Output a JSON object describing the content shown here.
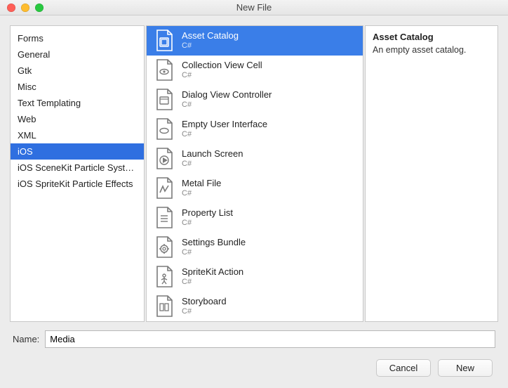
{
  "window": {
    "title": "New File"
  },
  "categories": [
    {
      "label": "Forms",
      "selected": false
    },
    {
      "label": "General",
      "selected": false
    },
    {
      "label": "Gtk",
      "selected": false
    },
    {
      "label": "Misc",
      "selected": false
    },
    {
      "label": "Text Templating",
      "selected": false
    },
    {
      "label": "Web",
      "selected": false
    },
    {
      "label": "XML",
      "selected": false
    },
    {
      "label": "iOS",
      "selected": true
    },
    {
      "label": "iOS SceneKit Particle Systems",
      "selected": false
    },
    {
      "label": "iOS SpriteKit Particle Effects",
      "selected": false
    }
  ],
  "templates": [
    {
      "label": "Asset Catalog",
      "sub": "C#",
      "icon": "asset-catalog-icon",
      "selected": true
    },
    {
      "label": "Collection View Cell",
      "sub": "C#",
      "icon": "view-cell-icon",
      "selected": false
    },
    {
      "label": "Dialog View Controller",
      "sub": "C#",
      "icon": "dialog-controller-icon",
      "selected": false
    },
    {
      "label": "Empty User Interface",
      "sub": "C#",
      "icon": "empty-ui-icon",
      "selected": false
    },
    {
      "label": "Launch Screen",
      "sub": "C#",
      "icon": "launch-screen-icon",
      "selected": false
    },
    {
      "label": "Metal File",
      "sub": "C#",
      "icon": "metal-file-icon",
      "selected": false
    },
    {
      "label": "Property List",
      "sub": "C#",
      "icon": "property-list-icon",
      "selected": false
    },
    {
      "label": "Settings Bundle",
      "sub": "C#",
      "icon": "settings-bundle-icon",
      "selected": false
    },
    {
      "label": "SpriteKit Action",
      "sub": "C#",
      "icon": "spritekit-action-icon",
      "selected": false
    },
    {
      "label": "Storyboard",
      "sub": "C#",
      "icon": "storyboard-icon",
      "selected": false
    }
  ],
  "description": {
    "title": "Asset Catalog",
    "body": "An empty asset catalog."
  },
  "name_field": {
    "label": "Name:",
    "value": "Media"
  },
  "buttons": {
    "cancel": "Cancel",
    "new": "New"
  }
}
